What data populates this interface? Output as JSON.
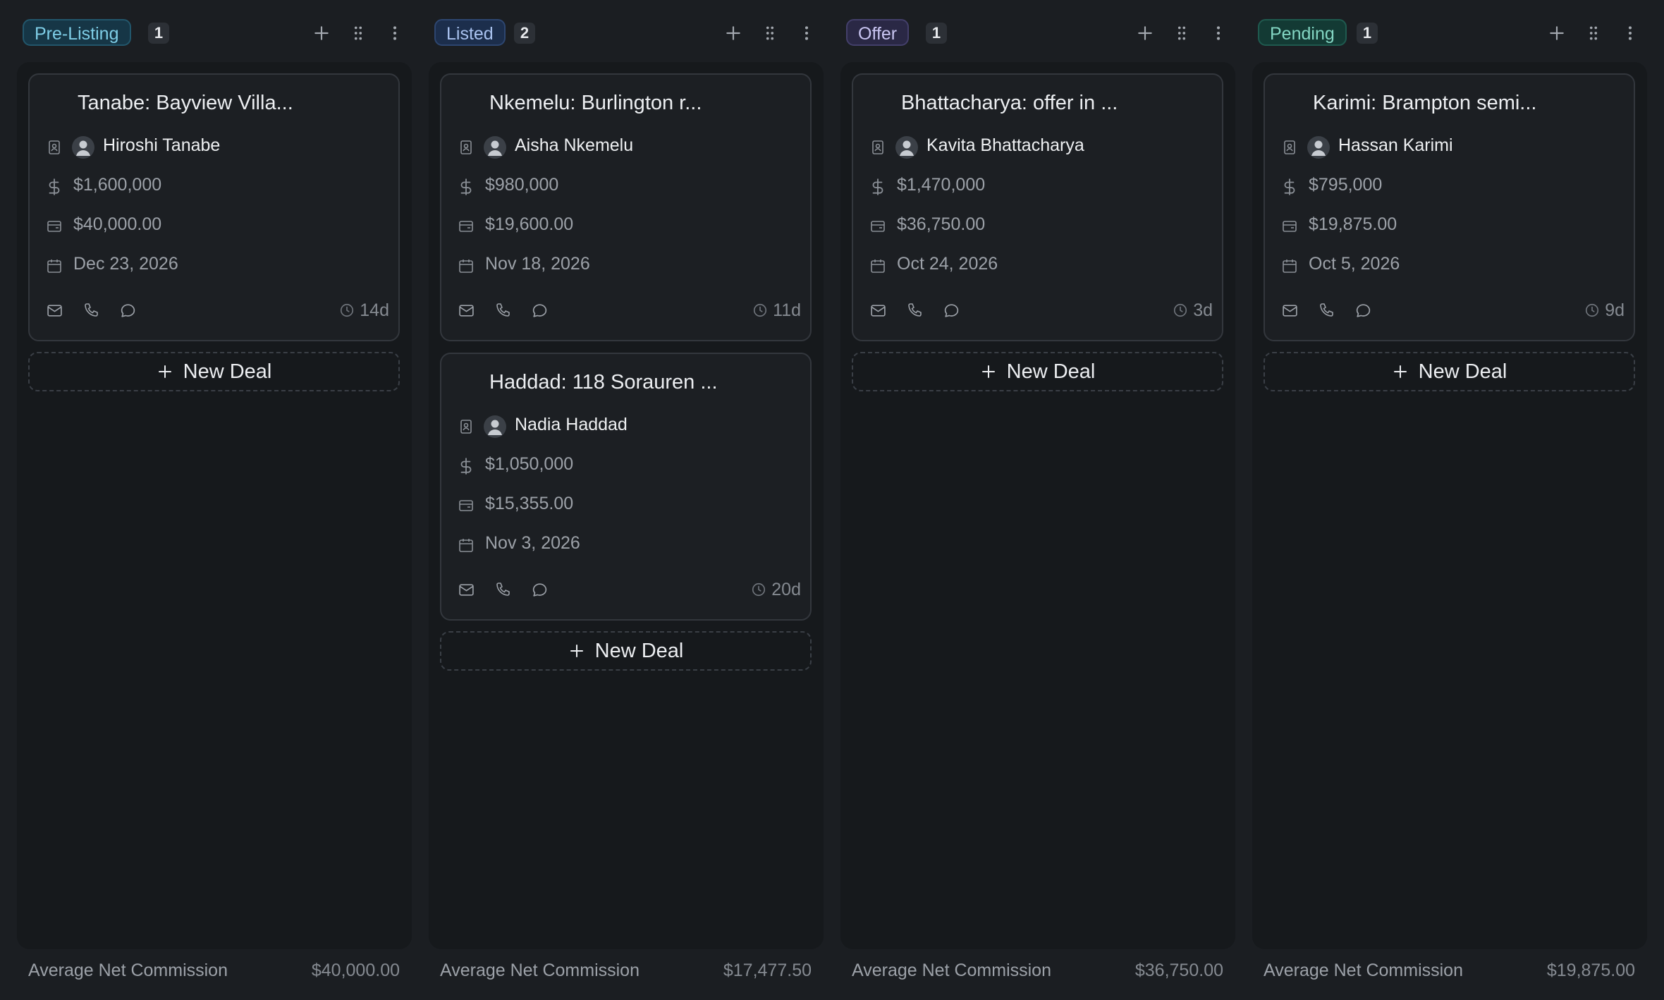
{
  "icons": {
    "add": "plus-icon",
    "drag": "drag-handle-icon",
    "more": "more-vertical-icon",
    "contact": "contact-card-icon",
    "avatar": "avatar-icon",
    "price": "dollar-icon",
    "commission": "wallet-icon",
    "date": "calendar-icon",
    "email": "mail-icon",
    "phone": "phone-icon",
    "chat": "chat-icon",
    "age": "clock-icon"
  },
  "colors": {
    "pre_listing": "#7ecde6",
    "listed": "#a9c2ef",
    "offer": "#c9c5f2",
    "pending": "#83d6c3"
  },
  "columns": [
    {
      "stage": "Pre-Listing",
      "count": "1",
      "new_deal_label": "New Deal",
      "footer_label": "Average Net Commission",
      "footer_value": "$40,000.00",
      "cards": [
        {
          "title": "Tanabe: Bayview Villa...",
          "contact": "Hiroshi Tanabe",
          "price": "$1,600,000",
          "commission": "$40,000.00",
          "date": "Dec 23, 2026",
          "age": "14d"
        }
      ]
    },
    {
      "stage": "Listed",
      "count": "2",
      "new_deal_label": "New Deal",
      "footer_label": "Average Net Commission",
      "footer_value": "$17,477.50",
      "cards": [
        {
          "title": "Nkemelu: Burlington r...",
          "contact": "Aisha Nkemelu",
          "price": "$980,000",
          "commission": "$19,600.00",
          "date": "Nov 18, 2026",
          "age": "11d"
        },
        {
          "title": "Haddad: 118 Sorauren ...",
          "contact": "Nadia Haddad",
          "price": "$1,050,000",
          "commission": "$15,355.00",
          "date": "Nov 3, 2026",
          "age": "20d"
        }
      ]
    },
    {
      "stage": "Offer",
      "count": "1",
      "new_deal_label": "New Deal",
      "footer_label": "Average Net Commission",
      "footer_value": "$36,750.00",
      "cards": [
        {
          "title": "Bhattacharya: offer in ...",
          "contact": "Kavita Bhattacharya",
          "price": "$1,470,000",
          "commission": "$36,750.00",
          "date": "Oct 24, 2026",
          "age": "3d"
        }
      ]
    },
    {
      "stage": "Pending",
      "count": "1",
      "new_deal_label": "New Deal",
      "footer_label": "Average Net Commission",
      "footer_value": "$19,875.00",
      "cards": [
        {
          "title": "Karimi: Brampton semi...",
          "contact": "Hassan Karimi",
          "price": "$795,000",
          "commission": "$19,875.00",
          "date": "Oct 5, 2026",
          "age": "9d"
        }
      ]
    }
  ]
}
